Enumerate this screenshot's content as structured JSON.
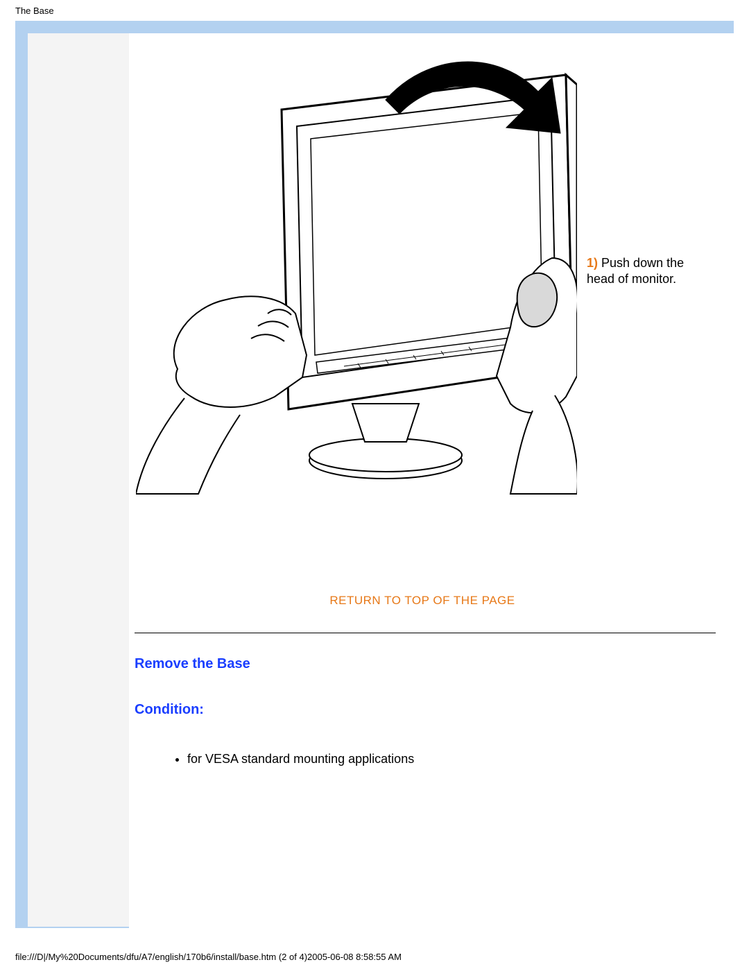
{
  "page_header": "The Base",
  "step": {
    "number_label": "1)",
    "text": "Push down the head of monitor."
  },
  "return_link": "RETURN TO TOP OF THE PAGE",
  "headings": {
    "remove_base": "Remove the Base",
    "condition": "Condition:"
  },
  "bullets": [
    "for VESA standard mounting applications"
  ],
  "footer": "file:///D|/My%20Documents/dfu/A7/english/170b6/install/base.htm (2 of 4)2005-06-08 8:58:55 AM"
}
